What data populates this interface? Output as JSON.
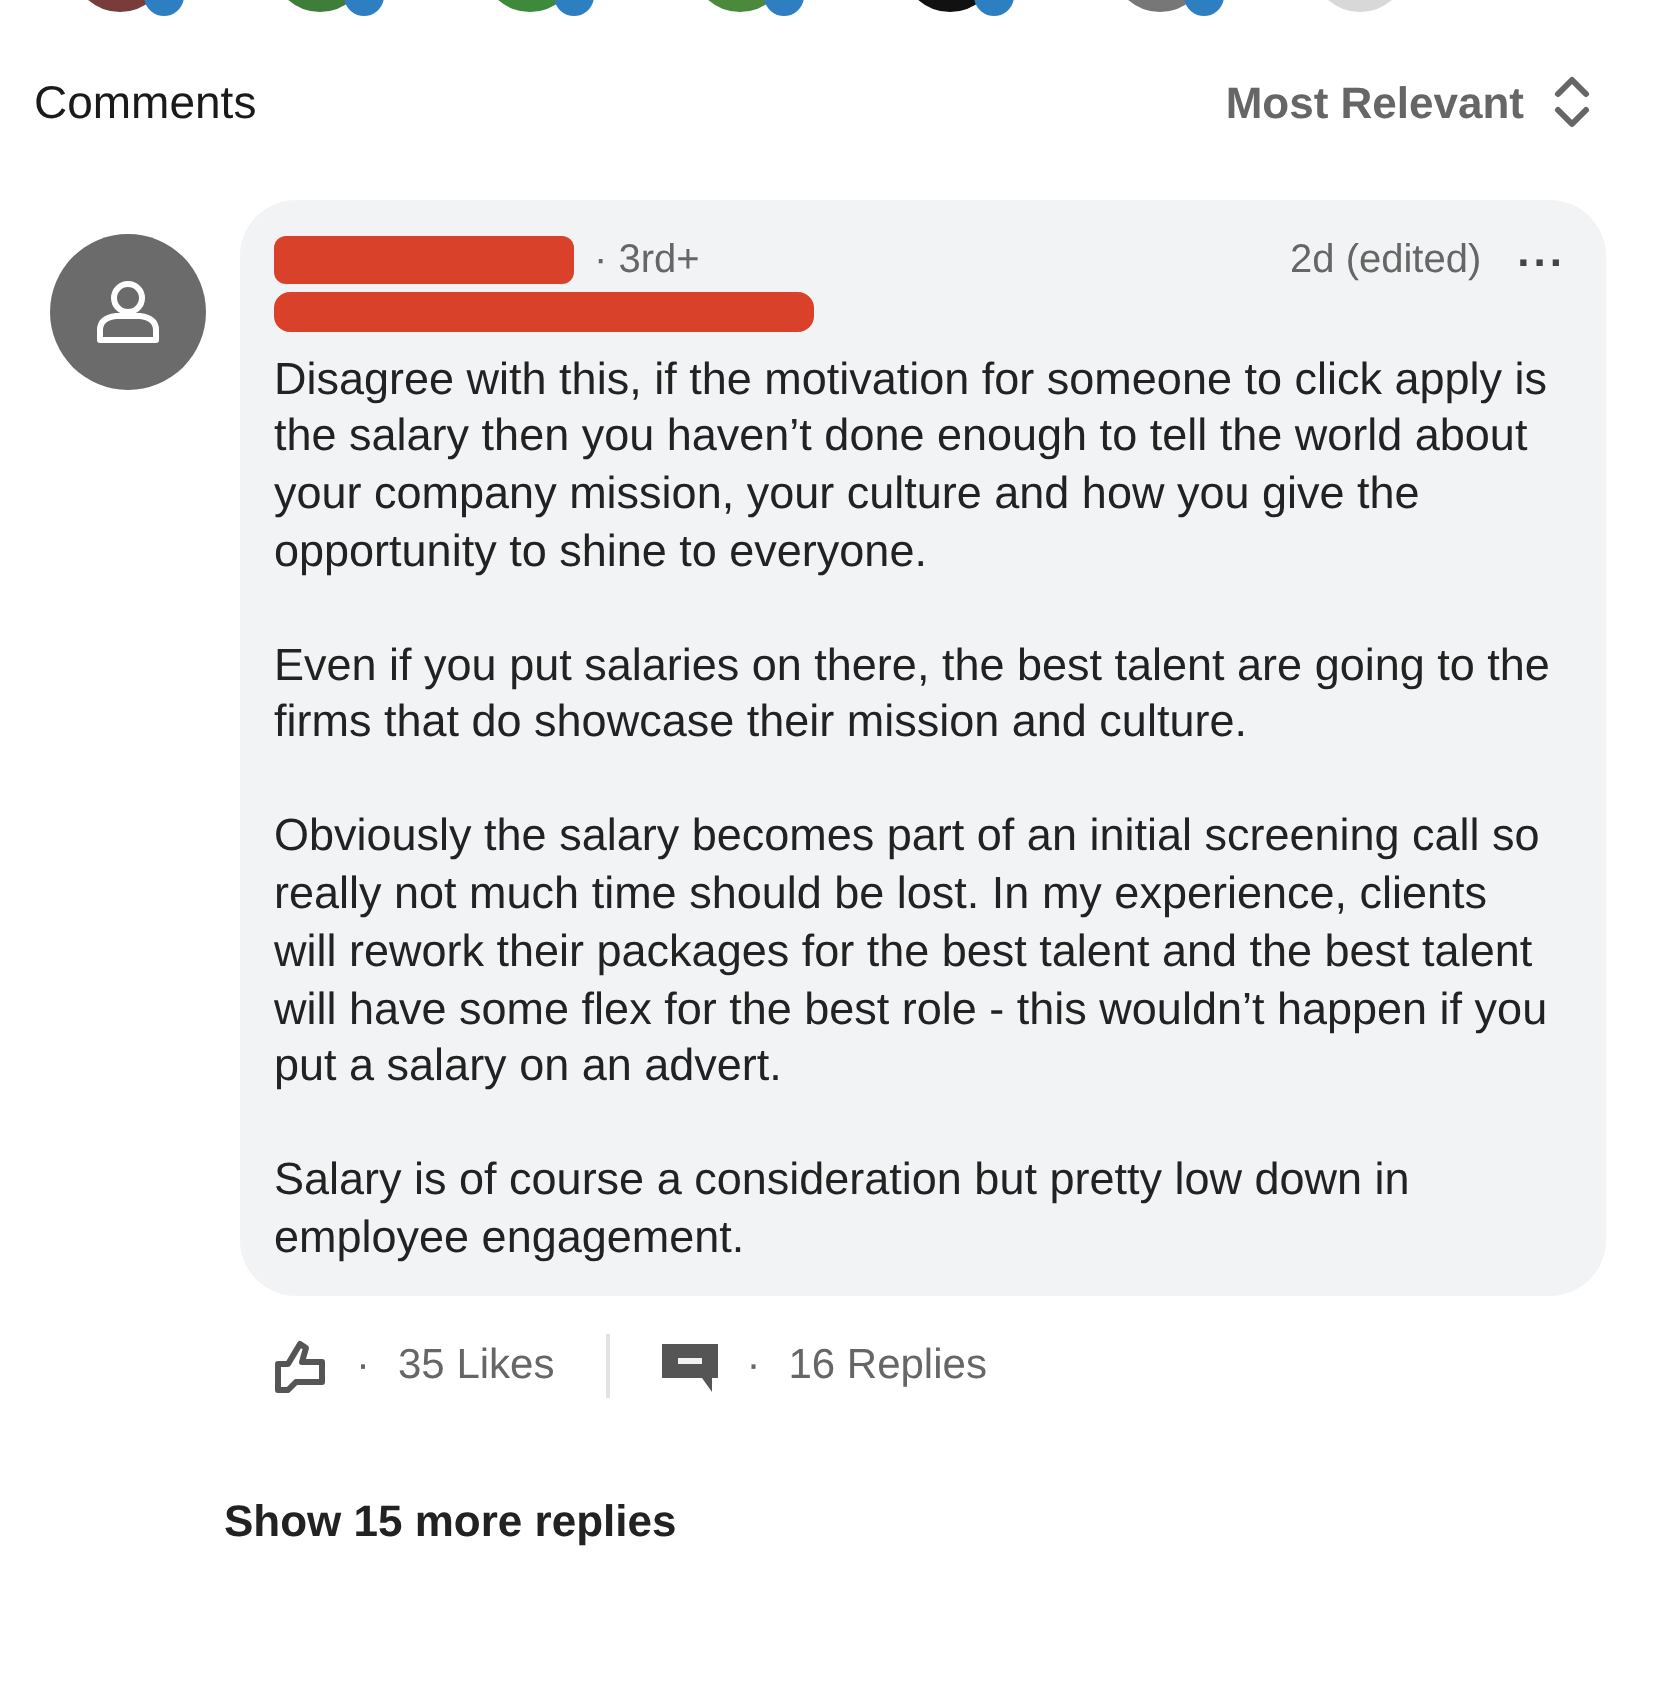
{
  "header": {
    "title": "Comments",
    "sort": "Most Relevant"
  },
  "comment": {
    "degree": "· 3rd+",
    "time": "2d (edited)",
    "more": "...",
    "paragraphs": [
      "Disagree with this, if the motivation for someone to click apply is the salary then you haven’t done enough to tell the world about your company mission, your culture and how you give the opportunity to shine to everyone.",
      "Even if you put salaries on there, the best talent are going to the firms that do showcase their mission and culture.",
      "Obviously the salary becomes part of an initial screening call so really not much time should be lost. In my experience, clients will rework their packages for the best talent and the best talent will have some flex for the best role - this wouldn’t happen if you put a salary on an advert.",
      "Salary is of course a consideration but pretty low down in employee engagement."
    ],
    "separator": "·",
    "likes": "35 Likes",
    "replies": "16 Replies"
  },
  "show_more": "Show 15 more replies"
}
